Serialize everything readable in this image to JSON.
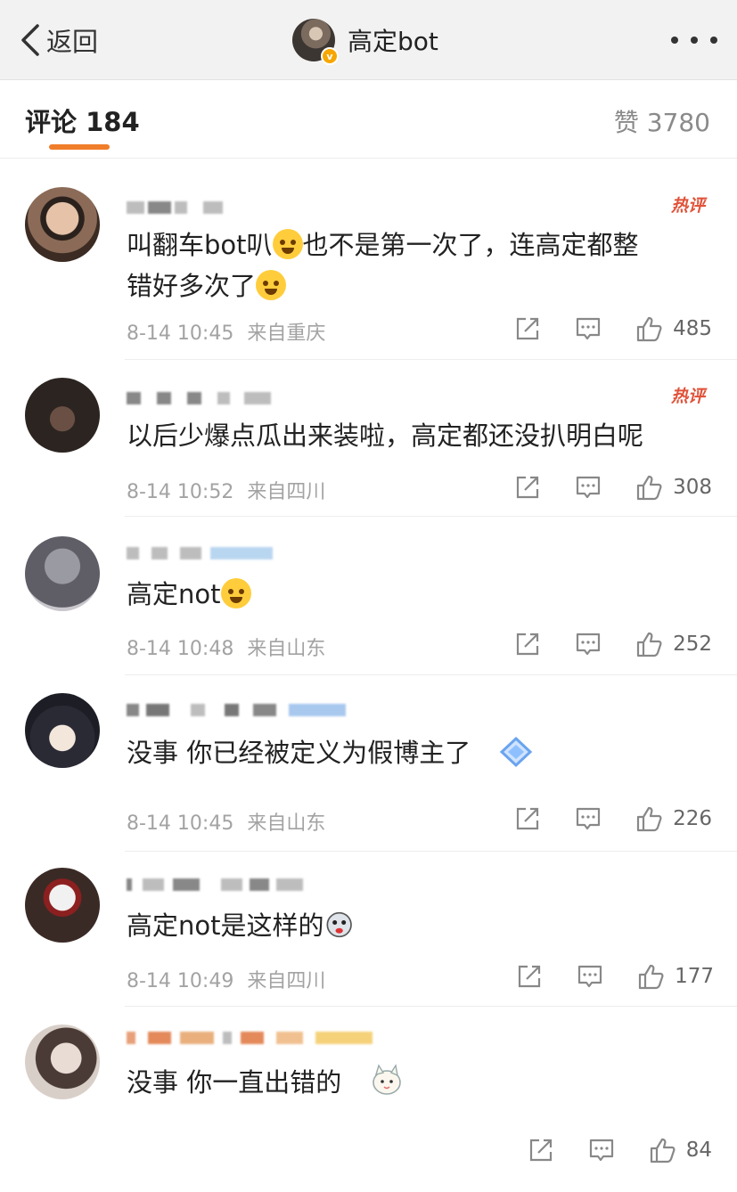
{
  "nav": {
    "back_label": "返回",
    "title": "高定bot",
    "badge": "v"
  },
  "tabs": {
    "comments_label": "评论 184",
    "likes_label": "赞 3780",
    "active_color": "#f07d2a"
  },
  "comments": [
    {
      "hot_tag": "热评",
      "text_parts": [
        "叫翻车bot叭",
        "也不是第一次了，连高定都整",
        "错好多次了"
      ],
      "time": "8-14 10:45",
      "location": "来自重庆",
      "likes": "485"
    },
    {
      "hot_tag": "热评",
      "text_parts": [
        "以后少爆点瓜出来装啦，高定都还没扒明白呢"
      ],
      "time": "8-14 10:52",
      "location": "来自四川",
      "likes": "308"
    },
    {
      "text_parts": [
        "高定not"
      ],
      "time": "8-14 10:48",
      "location": "来自山东",
      "likes": "252"
    },
    {
      "text_parts": [
        "没事 你已经被定义为假博主了"
      ],
      "time": "8-14 10:45",
      "location": "来自山东",
      "likes": "226"
    },
    {
      "text_parts": [
        "高定not是这样的"
      ],
      "time": "8-14 10:49",
      "location": "来自四川",
      "likes": "177"
    },
    {
      "text_parts": [
        "没事 你一直出错的"
      ],
      "time": "",
      "location": "",
      "likes": "84"
    }
  ]
}
